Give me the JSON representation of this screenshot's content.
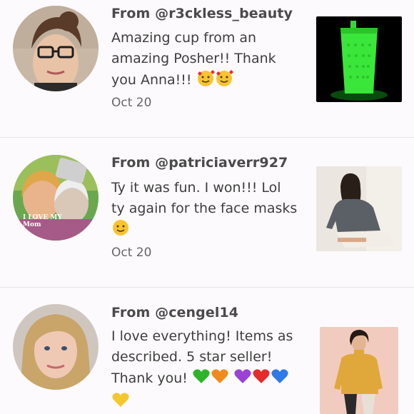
{
  "reviews": [
    {
      "from": "From @r3ckless_beauty",
      "message": "Amazing cup from an amazing Posher!! Thank you Anna!!!",
      "emojis": [
        "smiling-face-with-hearts",
        "smiling-face-with-hearts"
      ],
      "date": "Oct 20",
      "avatar": "user-avatar-r3ckless-beauty",
      "item": "green-studded-tumbler-photo"
    },
    {
      "from": "From @patriciaverr927",
      "message": "Ty it was fun. I won!!! Lol ty again for the face masks",
      "emojis": [
        "slightly-smiling-face"
      ],
      "date": "Oct 20",
      "avatar": "user-avatar-patriciaverr927",
      "avatar_text": "I LOVE MY Mom",
      "item": "gray-sweater-photo"
    },
    {
      "from": "From @cengel14",
      "message": "I love everything! Items as described. 5 star seller! Thank you!",
      "emojis": [
        "green-heart",
        "orange-heart",
        "purple-heart",
        "red-heart",
        "blue-heart",
        "yellow-heart"
      ],
      "avatar": "user-avatar-cengel14",
      "item": "mustard-turtleneck-photo"
    }
  ],
  "colors": {
    "background": "#fcfafc",
    "divider": "#e6e2e6",
    "heart_green": "#2db52a",
    "heart_orange": "#f08a1d",
    "heart_purple": "#9a42d6",
    "heart_red": "#e52b2b",
    "heart_blue": "#2f7ae6",
    "heart_yellow": "#f5c72e"
  }
}
